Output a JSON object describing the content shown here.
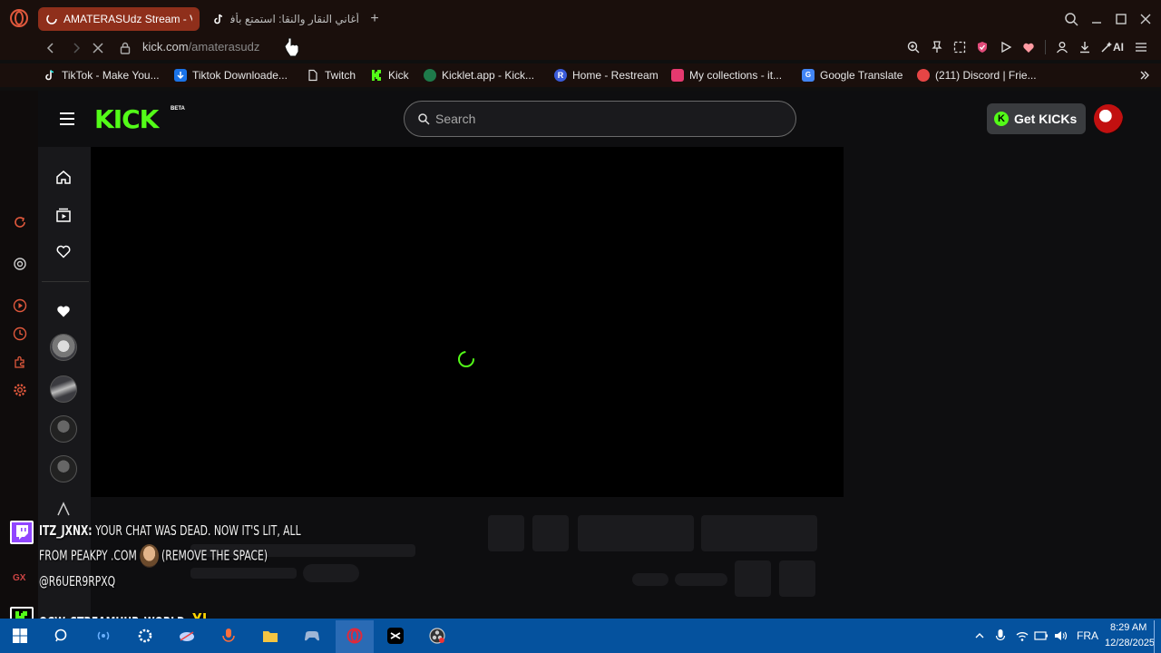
{
  "browser": {
    "tabs": [
      {
        "title": "AMATERASUdz Stream - V",
        "active": true
      },
      {
        "title": "أغاني النقار والنقا: استمتع بأفض",
        "active": false
      }
    ],
    "url": {
      "host": "kick.com",
      "path": "/amaterasudz"
    },
    "ai_label": "AI",
    "bookmarks": [
      {
        "label": "TikTok - Make You...",
        "icon": "tiktok-icon"
      },
      {
        "label": "Tiktok Downloade...",
        "icon": "download-icon"
      },
      {
        "label": "Twitch",
        "icon": "page-icon"
      },
      {
        "label": "Kick",
        "icon": "kick-icon"
      },
      {
        "label": "Kicklet.app - Kick...",
        "icon": "kicklet-icon"
      },
      {
        "label": "Home - Restream",
        "icon": "restream-icon"
      },
      {
        "label": "My collections - it...",
        "icon": "collections-icon"
      },
      {
        "label": "Google Translate",
        "icon": "translate-icon"
      },
      {
        "label": "(211) Discord | Frie...",
        "icon": "discord-icon"
      }
    ]
  },
  "kick": {
    "logo": "KICK",
    "beta": "BETA",
    "search_placeholder": "Search",
    "get_kicks": "Get KICKs",
    "accent": "#53fc18"
  },
  "chat": {
    "messages": [
      {
        "user": "ITZ_JXNX:",
        "text1": "YOUR CHAT WAS DEAD. NOW IT'S LIT, ALL",
        "text2_a": "FROM PEAKPY .COM",
        "text2_b": "(REMOVE THE SPACE)",
        "text3": "@R6UER9RPXQ",
        "platform": "twitch"
      },
      {
        "user": "OCW_STREAMHUB_WORLD:",
        "text1": "XI",
        "platform": "kick"
      }
    ]
  },
  "taskbar": {
    "language": "FRA",
    "time": "8:29 AM",
    "date": "12/28/2025",
    "gx_label": "GX"
  }
}
